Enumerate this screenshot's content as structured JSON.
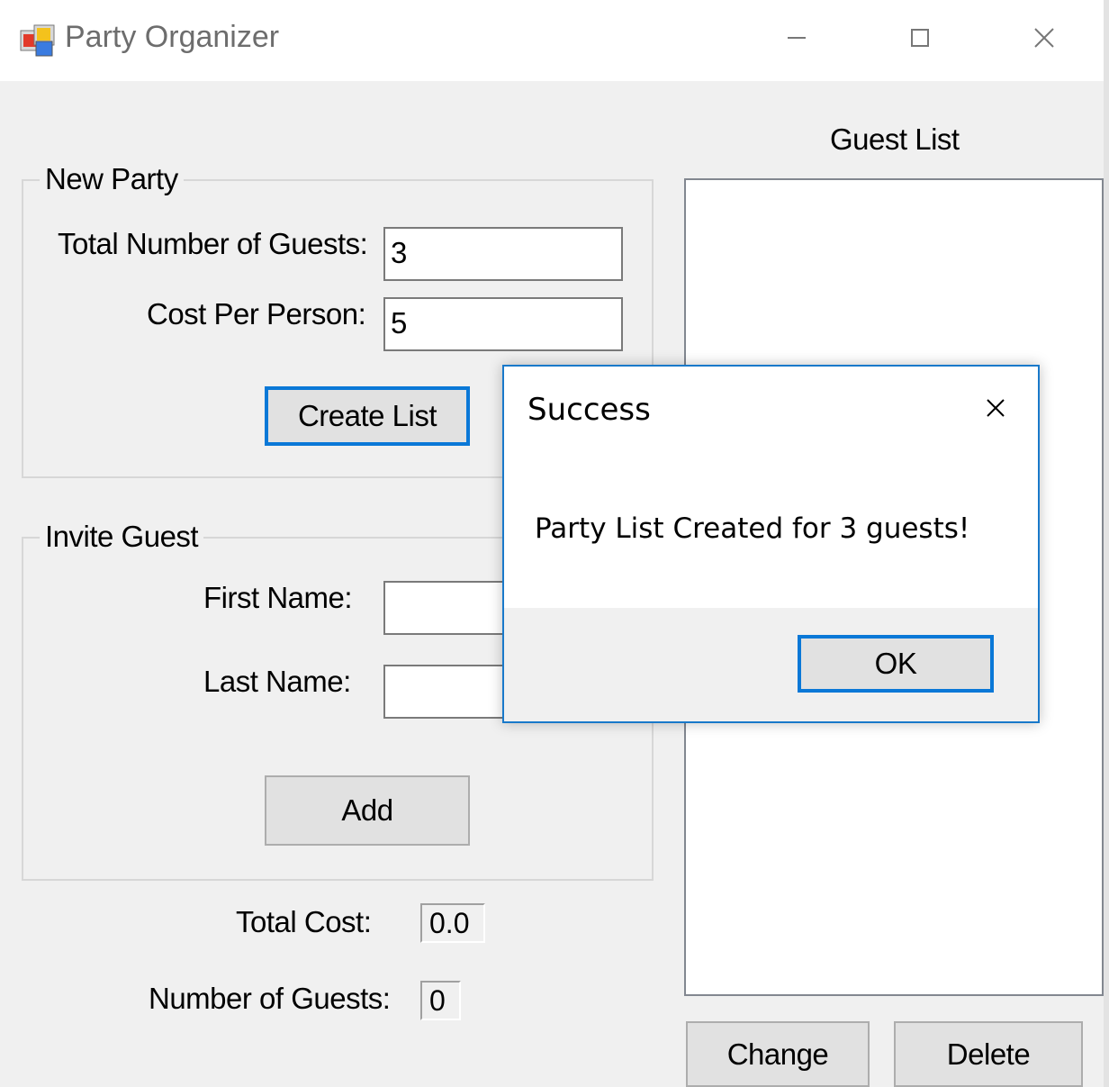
{
  "window": {
    "title": "Party Organizer",
    "icon": "app-windows-icon",
    "controls": [
      "minimize-icon",
      "maximize-icon",
      "close-icon"
    ]
  },
  "new_party": {
    "group_label": "New Party",
    "guests_label": "Total Number of Guests:",
    "guests_value": "3",
    "cost_label": "Cost Per Person:",
    "cost_value": "5",
    "create_button": "Create List"
  },
  "invite_guest": {
    "group_label": "Invite Guest",
    "first_name_label": "First Name:",
    "first_name_value": "",
    "last_name_label": "Last Name:",
    "last_name_value": "",
    "add_button": "Add"
  },
  "summary": {
    "total_cost_label": "Total Cost:",
    "total_cost_value": "0.0",
    "num_guests_label": "Number of Guests:",
    "num_guests_value": "0"
  },
  "guest_list": {
    "title": "Guest List",
    "items": [],
    "change_button": "Change",
    "delete_button": "Delete"
  },
  "dialog": {
    "title": "Success",
    "message": "Party List Created for 3 guests!",
    "ok_button": "OK"
  },
  "colors": {
    "accent": "#0a78d7",
    "window_bg": "#f0f0f0",
    "dialog_border": "#1979ca"
  }
}
